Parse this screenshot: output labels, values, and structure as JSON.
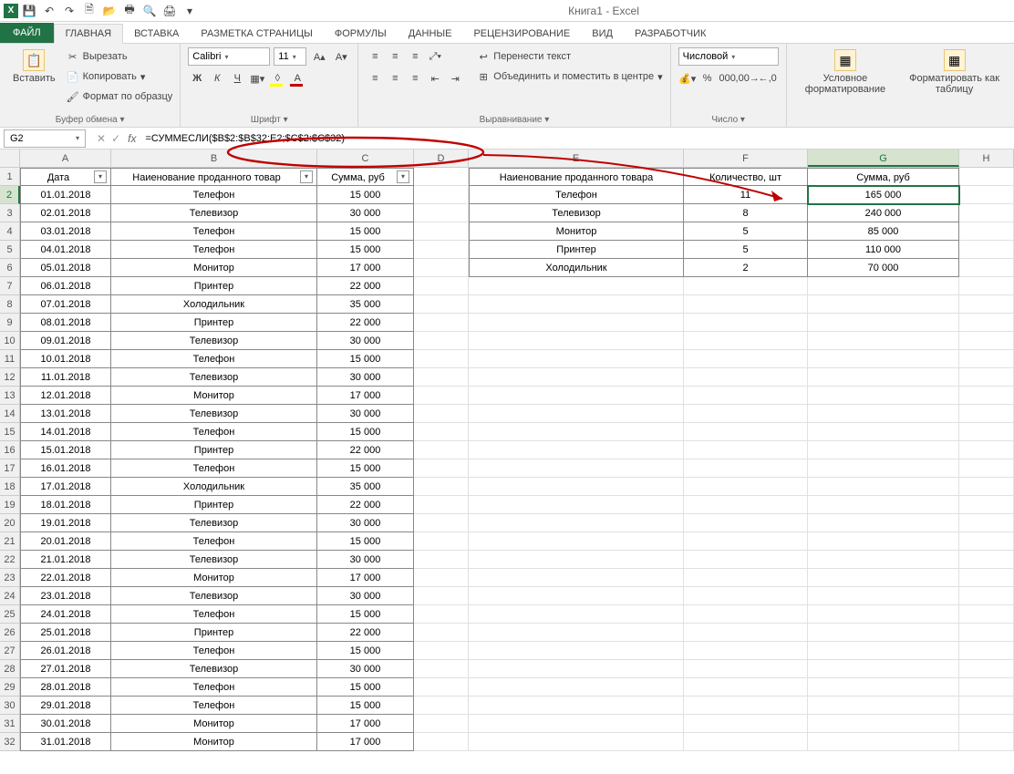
{
  "app": {
    "title": "Книга1 - Excel",
    "logo": "X"
  },
  "qat": {
    "save": "💾",
    "undo": "↶",
    "redo": "↷",
    "new": "🗎",
    "open": "📂",
    "print": "🖶",
    "preview": "🔍",
    "qprint": "🖨",
    "more": "▾"
  },
  "tabs": {
    "file": "ФАЙЛ",
    "home": "ГЛАВНАЯ",
    "insert": "ВСТАВКА",
    "layout": "РАЗМЕТКА СТРАНИЦЫ",
    "formulas": "ФОРМУЛЫ",
    "data": "ДАННЫЕ",
    "review": "РЕЦЕНЗИРОВАНИЕ",
    "view": "ВИД",
    "dev": "РАЗРАБОТЧИК"
  },
  "ribbon": {
    "clipboard": {
      "paste": "Вставить",
      "cut": "Вырезать",
      "copy": "Копировать",
      "format": "Формат по образцу",
      "label": "Буфер обмена"
    },
    "font": {
      "name": "Calibri",
      "size": "11",
      "label": "Шрифт"
    },
    "align": {
      "wrap": "Перенести текст",
      "merge": "Объединить и поместить в центре",
      "label": "Выравнивание"
    },
    "number": {
      "format": "Числовой",
      "label": "Число"
    },
    "styles": {
      "cond": "Условное форматирование",
      "table": "Форматировать как таблицу"
    }
  },
  "formula_bar": {
    "cell": "G2",
    "formula": "=СУММЕСЛИ($B$2:$B$32;E2;$C$2:$C$32)"
  },
  "headers": {
    "A": "Дата",
    "B": "Наиенование проданного товар",
    "C": "Сумма, руб",
    "E": "Наиенование проданного товара",
    "F": "Количество, шт",
    "G": "Сумма, руб"
  },
  "table1": [
    {
      "d": "01.01.2018",
      "n": "Телефон",
      "s": "15 000"
    },
    {
      "d": "02.01.2018",
      "n": "Телевизор",
      "s": "30 000"
    },
    {
      "d": "03.01.2018",
      "n": "Телефон",
      "s": "15 000"
    },
    {
      "d": "04.01.2018",
      "n": "Телефон",
      "s": "15 000"
    },
    {
      "d": "05.01.2018",
      "n": "Монитор",
      "s": "17 000"
    },
    {
      "d": "06.01.2018",
      "n": "Принтер",
      "s": "22 000"
    },
    {
      "d": "07.01.2018",
      "n": "Холодильник",
      "s": "35 000"
    },
    {
      "d": "08.01.2018",
      "n": "Принтер",
      "s": "22 000"
    },
    {
      "d": "09.01.2018",
      "n": "Телевизор",
      "s": "30 000"
    },
    {
      "d": "10.01.2018",
      "n": "Телефон",
      "s": "15 000"
    },
    {
      "d": "11.01.2018",
      "n": "Телевизор",
      "s": "30 000"
    },
    {
      "d": "12.01.2018",
      "n": "Монитор",
      "s": "17 000"
    },
    {
      "d": "13.01.2018",
      "n": "Телевизор",
      "s": "30 000"
    },
    {
      "d": "14.01.2018",
      "n": "Телефон",
      "s": "15 000"
    },
    {
      "d": "15.01.2018",
      "n": "Принтер",
      "s": "22 000"
    },
    {
      "d": "16.01.2018",
      "n": "Телефон",
      "s": "15 000"
    },
    {
      "d": "17.01.2018",
      "n": "Холодильник",
      "s": "35 000"
    },
    {
      "d": "18.01.2018",
      "n": "Принтер",
      "s": "22 000"
    },
    {
      "d": "19.01.2018",
      "n": "Телевизор",
      "s": "30 000"
    },
    {
      "d": "20.01.2018",
      "n": "Телефон",
      "s": "15 000"
    },
    {
      "d": "21.01.2018",
      "n": "Телевизор",
      "s": "30 000"
    },
    {
      "d": "22.01.2018",
      "n": "Монитор",
      "s": "17 000"
    },
    {
      "d": "23.01.2018",
      "n": "Телевизор",
      "s": "30 000"
    },
    {
      "d": "24.01.2018",
      "n": "Телефон",
      "s": "15 000"
    },
    {
      "d": "25.01.2018",
      "n": "Принтер",
      "s": "22 000"
    },
    {
      "d": "26.01.2018",
      "n": "Телефон",
      "s": "15 000"
    },
    {
      "d": "27.01.2018",
      "n": "Телевизор",
      "s": "30 000"
    },
    {
      "d": "28.01.2018",
      "n": "Телефон",
      "s": "15 000"
    },
    {
      "d": "29.01.2018",
      "n": "Телефон",
      "s": "15 000"
    },
    {
      "d": "30.01.2018",
      "n": "Монитор",
      "s": "17 000"
    },
    {
      "d": "31.01.2018",
      "n": "Монитор",
      "s": "17 000"
    }
  ],
  "table2": [
    {
      "n": "Телефон",
      "q": "11",
      "s": "165 000"
    },
    {
      "n": "Телевизор",
      "q": "8",
      "s": "240 000"
    },
    {
      "n": "Монитор",
      "q": "5",
      "s": "85 000"
    },
    {
      "n": "Принтер",
      "q": "5",
      "s": "110 000"
    },
    {
      "n": "Холодильник",
      "q": "2",
      "s": "70 000"
    }
  ]
}
